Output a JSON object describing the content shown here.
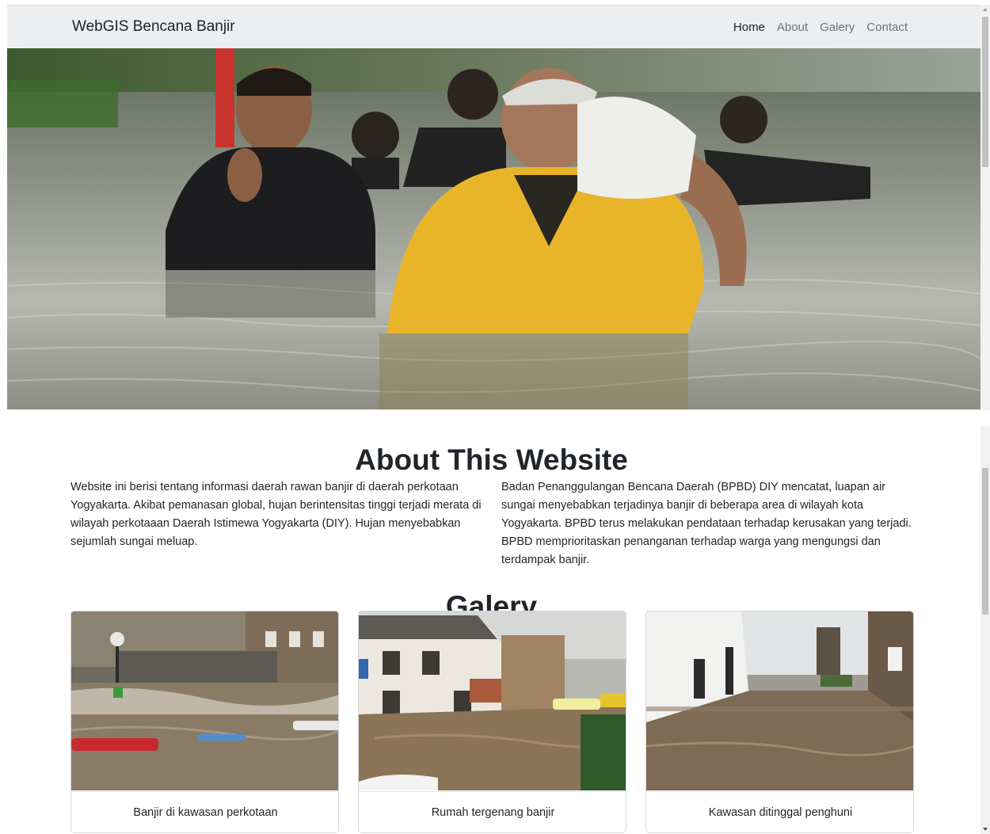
{
  "navbar": {
    "brand": "WebGIS Bencana Banjir",
    "items": [
      {
        "label": "Home",
        "active": true
      },
      {
        "label": "About",
        "active": false
      },
      {
        "label": "Galery",
        "active": false
      },
      {
        "label": "Contact",
        "active": false
      }
    ]
  },
  "about": {
    "title": "About This Website",
    "left_text": "Website ini berisi tentang informasi daerah rawan banjir di daerah perkotaan Yogyakarta. Akibat pemanasan global, hujan berintensitas tinggi terjadi merata di wilayah perkotaaan Daerah Istimewa Yogyakarta (DIY). Hujan menyebabkan sejumlah sungai meluap.",
    "right_text": "Badan Penanggulangan Bencana Daerah (BPBD) DIY mencatat, luapan air sungai menyebabkan terjadinya banjir di beberapa area di wilayah kota Yogyakarta. BPBD terus melakukan pendataan terhadap kerusakan yang terjadi. BPBD memprioritaskan penanganan terhadap warga yang mengungsi dan terdampak banjir."
  },
  "gallery": {
    "title": "Galery",
    "cards": [
      {
        "caption": "Banjir di kawasan perkotaan"
      },
      {
        "caption": "Rumah tergenang banjir"
      },
      {
        "caption": "Kawasan ditinggal penghuni"
      }
    ]
  }
}
